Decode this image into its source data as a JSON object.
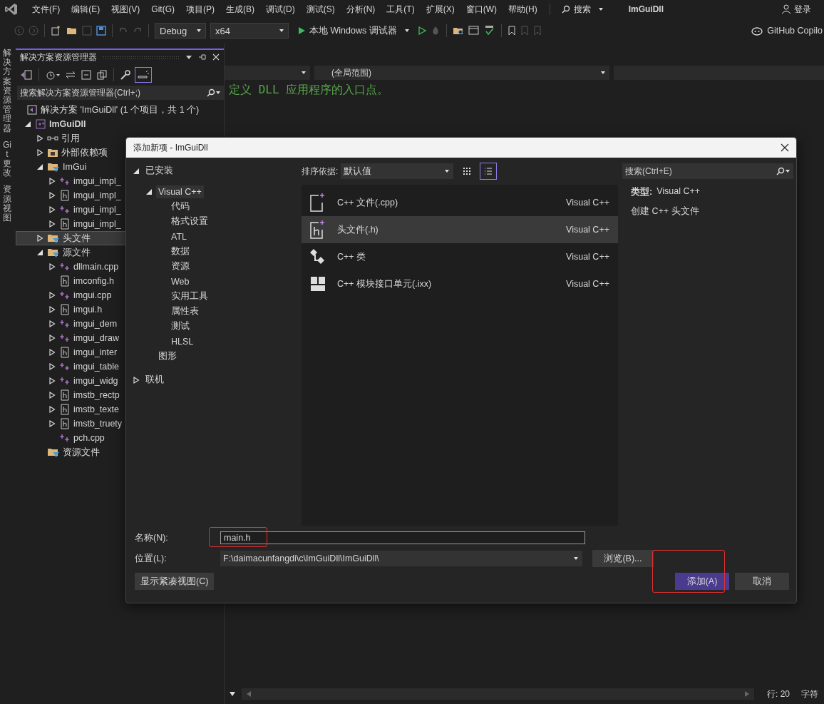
{
  "menubar": {
    "menus": [
      "文件(F)",
      "编辑(E)",
      "视图(V)",
      "Git(G)",
      "项目(P)",
      "生成(B)",
      "调试(D)",
      "测试(S)",
      "分析(N)",
      "工具(T)",
      "扩展(X)",
      "窗口(W)",
      "帮助(H)"
    ],
    "search": "搜索",
    "title": "ImGuiDll",
    "account": "登录"
  },
  "toolbar": {
    "configuration": "Debug",
    "platform": "x64",
    "run": "本地 Windows 调试器",
    "copilot": "GitHub Copilo"
  },
  "side_tabs": [
    "解决方案资源管理器",
    "Git 更改",
    "资源视图"
  ],
  "explorer": {
    "title": "解决方案资源管理器",
    "search": {
      "placeholder": "搜索解决方案资源管理器(Ctrl+;)"
    },
    "tree": [
      {
        "label": "解决方案 'ImGuiDll' (1 个项目，共 1 个)",
        "kind": "solution",
        "selected": false,
        "children": [
          {
            "label": "ImGuiDll",
            "kind": "project",
            "expanded": true,
            "selected": false,
            "children": [
              {
                "label": "引用",
                "kind": "reference",
                "expanded": false,
                "selected": false
              },
              {
                "label": "外部依赖项",
                "kind": "external",
                "expanded": false,
                "selected": false
              },
              {
                "label": "ImGui",
                "kind": "filter",
                "expanded": true,
                "selected": false,
                "children": [
                  {
                    "label": "imgui_impl_",
                    "kind": "cpp",
                    "expanded": false,
                    "selected": false
                  },
                  {
                    "label": "imgui_impl_",
                    "kind": "header",
                    "expanded": false,
                    "selected": false
                  },
                  {
                    "label": "imgui_impl_",
                    "kind": "cpp",
                    "expanded": false,
                    "selected": false
                  },
                  {
                    "label": "imgui_impl_",
                    "kind": "header",
                    "expanded": false,
                    "selected": false
                  }
                ]
              },
              {
                "label": "头文件",
                "kind": "filter",
                "expanded": false,
                "selected": true
              },
              {
                "label": "源文件",
                "kind": "filter",
                "expanded": true,
                "selected": false,
                "children": [
                  {
                    "label": "dllmain.cpp",
                    "kind": "cpp",
                    "expanded": false,
                    "selected": false
                  },
                  {
                    "label": "imconfig.h",
                    "kind": "header",
                    "selected": false
                  },
                  {
                    "label": "imgui.cpp",
                    "kind": "cpp",
                    "expanded": false,
                    "selected": false
                  },
                  {
                    "label": "imgui.h",
                    "kind": "header",
                    "expanded": false,
                    "selected": false
                  },
                  {
                    "label": "imgui_dem",
                    "kind": "cpp",
                    "expanded": false,
                    "selected": false
                  },
                  {
                    "label": "imgui_draw",
                    "kind": "cpp",
                    "expanded": false,
                    "selected": false
                  },
                  {
                    "label": "imgui_inter",
                    "kind": "header",
                    "expanded": false,
                    "selected": false
                  },
                  {
                    "label": "imgui_table",
                    "kind": "cpp",
                    "expanded": false,
                    "selected": false
                  },
                  {
                    "label": "imgui_widg",
                    "kind": "cpp",
                    "expanded": false,
                    "selected": false
                  },
                  {
                    "label": "imstb_rectp",
                    "kind": "header",
                    "expanded": false,
                    "selected": false
                  },
                  {
                    "label": "imstb_texte",
                    "kind": "header",
                    "expanded": false,
                    "selected": false
                  },
                  {
                    "label": "imstb_truety",
                    "kind": "header",
                    "expanded": false,
                    "selected": false
                  },
                  {
                    "label": "pch.cpp",
                    "kind": "cpp",
                    "selected": false
                  }
                ]
              },
              {
                "label": "资源文件",
                "kind": "filter",
                "selected": false
              }
            ]
          }
        ]
      }
    ]
  },
  "editor": {
    "scope": "(全局范围)",
    "comment": "定义 DLL 应用程序的入口点。",
    "status": {
      "line": "行: 20",
      "column": "字符"
    }
  },
  "dialog": {
    "title": "添加新项 - ImGuiDll",
    "categories": [
      {
        "label": "已安装",
        "expanded": true,
        "selected": false,
        "children": [
          {
            "label": "Visual C++",
            "expanded": true,
            "selected": true,
            "children": [
              {
                "label": "代码",
                "selected": false
              },
              {
                "label": "格式设置",
                "selected": false
              },
              {
                "label": "ATL",
                "selected": false
              },
              {
                "label": "数据",
                "selected": false
              },
              {
                "label": "资源",
                "selected": false
              },
              {
                "label": "Web",
                "selected": false
              },
              {
                "label": "实用工具",
                "selected": false
              },
              {
                "label": "属性表",
                "selected": false
              },
              {
                "label": "测试",
                "selected": false
              },
              {
                "label": "HLSL",
                "selected": false
              }
            ]
          },
          {
            "label": "图形",
            "selected": false
          }
        ]
      },
      {
        "label": "联机",
        "expanded": false,
        "selected": false
      }
    ],
    "sort_label": "排序依据:",
    "sort_value": "默认值",
    "list_view": true,
    "search": {
      "placeholder": "搜索(Ctrl+E)"
    },
    "templates": [
      {
        "name": "C++ 文件(.cpp)",
        "language": "Visual C++",
        "kind": "cpp",
        "selected": false
      },
      {
        "name": "头文件(.h)",
        "language": "Visual C++",
        "kind": "header",
        "selected": true
      },
      {
        "name": "C++ 类",
        "language": "Visual C++",
        "kind": "class",
        "selected": false
      },
      {
        "name": "C++ 模块接口单元(.ixx)",
        "language": "Visual C++",
        "kind": "module",
        "selected": false
      }
    ],
    "details": {
      "type_label": "类型:",
      "type_value": "Visual C++",
      "description": "创建 C++ 头文件"
    },
    "name": {
      "label": "名称(N):",
      "value": "main.h",
      "highlighted": true
    },
    "location": {
      "label": "位置(L):",
      "value": "F:\\daimacunfangdi\\c\\ImGuiDll\\ImGuiDll\\"
    },
    "browse": "浏览(B)...",
    "compact": "显示紧凑视图(C)",
    "add": {
      "label": "添加(A)",
      "highlighted": true
    },
    "cancel": "取消"
  }
}
